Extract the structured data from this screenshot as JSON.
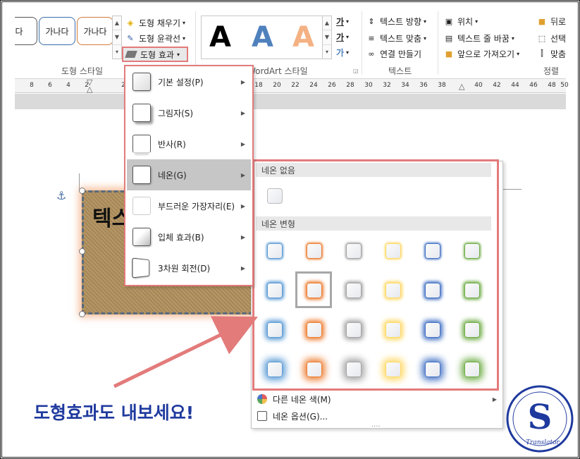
{
  "ribbon": {
    "shape_styles": [
      "다",
      "가나다",
      "가나다"
    ],
    "shape_fill": "도형 채우기",
    "shape_outline": "도형 윤곽선",
    "shape_effects": "도형 효과",
    "shape_styles_group": "도형 스타일",
    "wordart_letters": [
      "A",
      "A",
      "A"
    ],
    "wordart_group": "WordArt 스타일",
    "text_direction": "텍스트 방향",
    "align_text": "텍스트 맞춤",
    "create_link": "연결 만들기",
    "text_group": "텍스트",
    "position": "위치",
    "wrap_text": "텍스트 줄 바꿈",
    "bring_forward": "앞으로 가져오기",
    "send_backward": "뒤로",
    "selection": "선택",
    "align": "맞춤",
    "arrange_group": "정렬",
    "ga_glyphs": [
      "가",
      "가",
      "가"
    ]
  },
  "ruler": {
    "ticks": [
      "8",
      "6",
      "4",
      "2",
      "",
      "2",
      "18",
      "20",
      "22",
      "24",
      "26",
      "28",
      "30",
      "32",
      "34",
      "36",
      "38",
      "40",
      "42",
      "44",
      "46",
      "48",
      "50"
    ]
  },
  "document": {
    "shape_text": "텍스"
  },
  "effects_menu": {
    "items": [
      {
        "label": "기본 설정(P)"
      },
      {
        "label": "그림자(S)"
      },
      {
        "label": "반사(R)"
      },
      {
        "label": "네온(G)"
      },
      {
        "label": "부드러운 가장자리(E)"
      },
      {
        "label": "입체 효과(B)"
      },
      {
        "label": "3차원 회전(D)"
      }
    ]
  },
  "neon_panel": {
    "no_neon_header": "네온 없음",
    "variations_header": "네온 변형",
    "more_colors": "다른 네온 색(M)",
    "options": "네온 옵션(G)...",
    "grip": "....",
    "colors": [
      "#5b9bd5",
      "#ed7d31",
      "#a5a5a5",
      "#ffd966",
      "#4472c4",
      "#70ad47"
    ]
  },
  "callout": {
    "text": "도형효과도 내보세요!"
  },
  "logo": {
    "letter": "S",
    "caption": "Translator"
  }
}
